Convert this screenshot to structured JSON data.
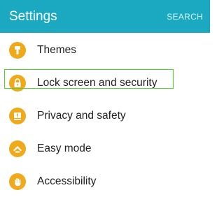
{
  "app_bar": {
    "title": "Settings",
    "search_label": "SEARCH",
    "color": "#1aa9c1"
  },
  "settings_list": {
    "icon_color": "#f0a91a",
    "items": [
      {
        "label": "Themes",
        "icon": "theme-brush-icon"
      },
      {
        "label": "Lock screen and security",
        "icon": "padlock-icon",
        "highlighted": true
      },
      {
        "label": "Privacy and safety",
        "icon": "shield-alert-icon"
      },
      {
        "label": "Easy mode",
        "icon": "easy-mode-icon"
      },
      {
        "label": "Accessibility",
        "icon": "hand-icon"
      }
    ]
  },
  "highlight_color": "#44dd22"
}
